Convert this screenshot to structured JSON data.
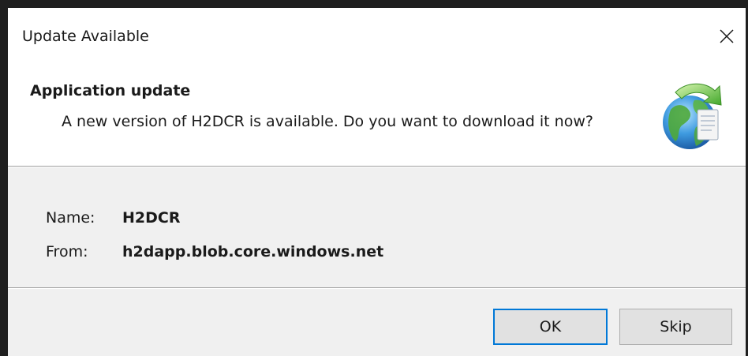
{
  "window": {
    "title": "Update Available",
    "close_glyph": "✕"
  },
  "header": {
    "title": "Application update",
    "message": "A new version of H2DCR is available. Do you want to download it now?",
    "icon": "globe-update-icon"
  },
  "details": {
    "name_label": "Name:",
    "name_value": "H2DCR",
    "from_label": "From:",
    "from_value": "h2dapp.blob.core.windows.net"
  },
  "buttons": {
    "ok_label": "OK",
    "skip_label": "Skip"
  },
  "colors": {
    "accent": "#0078d7",
    "panel": "#f0f0f0",
    "frame": "#1f1f1f"
  }
}
